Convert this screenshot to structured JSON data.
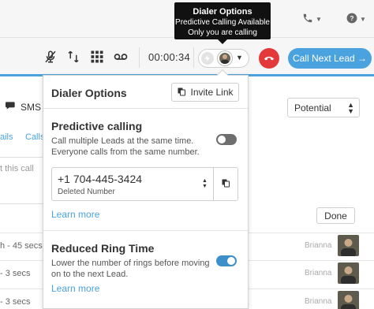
{
  "header": {
    "phone_icon": "phone-icon",
    "help_icon": "help-icon"
  },
  "tooltip": {
    "title": "Dialer Options",
    "line1": "Predictive Calling Available",
    "line2": "Only you are calling"
  },
  "toolbar": {
    "icons": [
      "mute-mic-icon",
      "transfer-icon",
      "keypad-icon",
      "voicemail-icon"
    ],
    "timer": "00:00:34",
    "call_next_label": "Call Next Lead →",
    "hangup_icon": "hangup-icon"
  },
  "background": {
    "sms_tab": "SMS",
    "link_fragment_1": "ails",
    "link_fragment_2": "Calls",
    "status_select": "Potential",
    "note_placeholder_fragment": "t this call",
    "done_label": "Done",
    "history": [
      {
        "duration": "h - 45 secs",
        "user": "Brianna"
      },
      {
        "duration": "- 3 secs",
        "user": "Brianna"
      },
      {
        "duration": "- 3 secs",
        "user": "Brianna"
      }
    ]
  },
  "panel": {
    "title": "Dialer Options",
    "invite_link_label": "Invite Link",
    "predictive": {
      "heading": "Predictive calling",
      "desc_line1": "Call multiple Leads at the same time.",
      "desc_line2": "Everyone calls from the same number.",
      "enabled": false
    },
    "number": {
      "value": "+1 704-445-3424",
      "status": "Deleted Number"
    },
    "learn_more_1": "Learn more",
    "reduced": {
      "heading": "Reduced Ring Time",
      "desc_line1": "Lower the number of rings before moving",
      "desc_line2": "on to the next Lead.",
      "enabled": true
    },
    "learn_more_2": "Learn more"
  },
  "colors": {
    "accent": "#4aa3df",
    "hangup": "#e4393b",
    "toggle_on": "#3d8fc9",
    "toggle_off": "#6e6e6e"
  }
}
